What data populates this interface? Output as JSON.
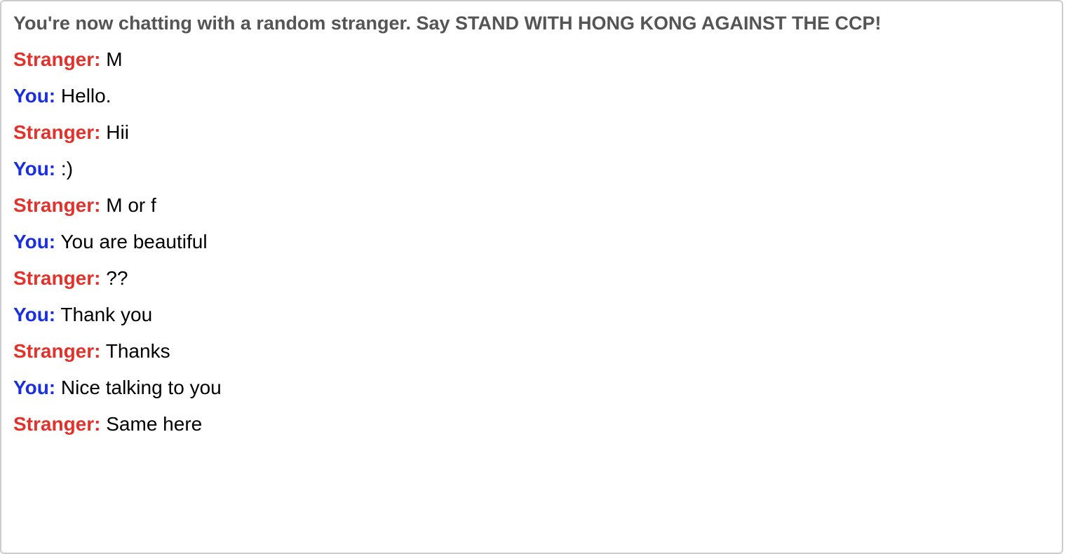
{
  "status": {
    "text": "You're now chatting with a random stranger. Say STAND WITH HONG KONG AGAINST THE CCP!"
  },
  "colors": {
    "stranger": "#e2322b",
    "you": "#1a2fe0",
    "status": "#555555"
  },
  "messages": [
    {
      "speaker": "Stranger:",
      "role": "stranger",
      "text": "M"
    },
    {
      "speaker": "You:",
      "role": "you",
      "text": "Hello."
    },
    {
      "speaker": "Stranger:",
      "role": "stranger",
      "text": "Hii"
    },
    {
      "speaker": "You:",
      "role": "you",
      "text": ":)"
    },
    {
      "speaker": "Stranger:",
      "role": "stranger",
      "text": "M or f"
    },
    {
      "speaker": "You:",
      "role": "you",
      "text": "You are beautiful"
    },
    {
      "speaker": "Stranger:",
      "role": "stranger",
      "text": "??"
    },
    {
      "speaker": "You:",
      "role": "you",
      "text": "Thank you"
    },
    {
      "speaker": "Stranger:",
      "role": "stranger",
      "text": "Thanks"
    },
    {
      "speaker": "You:",
      "role": "you",
      "text": "Nice talking to you"
    },
    {
      "speaker": "Stranger:",
      "role": "stranger",
      "text": "Same here"
    }
  ]
}
